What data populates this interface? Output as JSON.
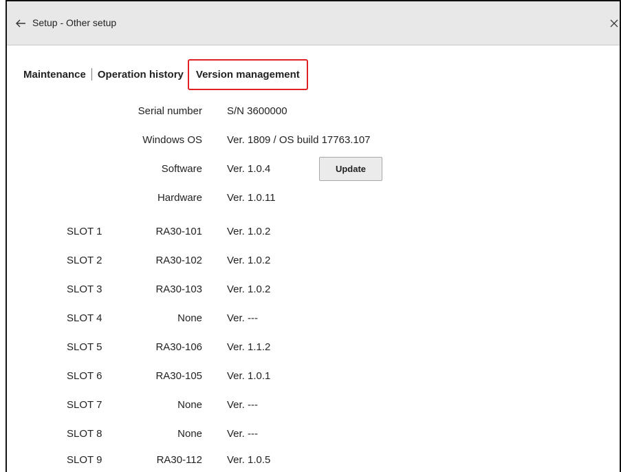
{
  "window": {
    "title": "Setup - Other setup",
    "back_icon": "left-arrow-icon",
    "close_icon": "close-icon"
  },
  "tabs": [
    {
      "label": "Maintenance",
      "active": false
    },
    {
      "label": "Operation history",
      "active": false
    },
    {
      "label": "Version management",
      "active": true
    }
  ],
  "info": [
    {
      "label": "Serial number",
      "value": "S/N 3600000"
    },
    {
      "label": "Windows OS",
      "value": "Ver. 1809 / OS build 17763.107"
    },
    {
      "label": "Software",
      "value": "Ver. 1.0.4"
    },
    {
      "label": "Hardware",
      "value": "Ver. 1.0.11"
    }
  ],
  "update_button": {
    "label": "Update"
  },
  "slots": [
    {
      "slot": "SLOT 1",
      "module": "RA30-101",
      "version": "Ver. 1.0.2"
    },
    {
      "slot": "SLOT 2",
      "module": "RA30-102",
      "version": "Ver. 1.0.2"
    },
    {
      "slot": "SLOT 3",
      "module": "RA30-103",
      "version": "Ver. 1.0.2"
    },
    {
      "slot": "SLOT 4",
      "module": "None",
      "version": "Ver. ---"
    },
    {
      "slot": "SLOT 5",
      "module": "RA30-106",
      "version": "Ver. 1.1.2"
    },
    {
      "slot": "SLOT 6",
      "module": "RA30-105",
      "version": "Ver. 1.0.1"
    },
    {
      "slot": "SLOT 7",
      "module": "None",
      "version": "Ver. ---"
    },
    {
      "slot": "SLOT 8",
      "module": "None",
      "version": "Ver. ---"
    },
    {
      "slot": "SLOT 9",
      "module": "RA30-112",
      "version": "Ver. 1.0.5"
    }
  ],
  "colors": {
    "active_tab_border": "#e0201f",
    "titlebar_bg": "#e8e8e8"
  }
}
